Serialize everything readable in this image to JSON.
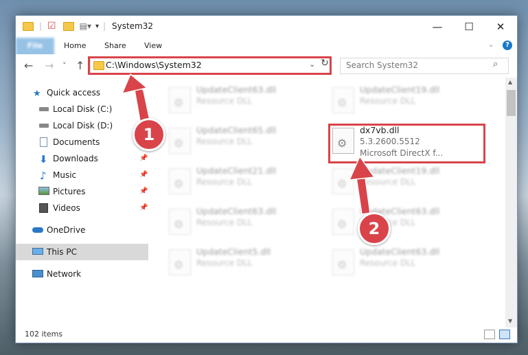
{
  "window": {
    "title": "System32",
    "controls": {
      "minimize": "—",
      "maximize": "☐",
      "close": "✕"
    }
  },
  "ribbon": {
    "tabs": [
      "File",
      "Home",
      "Share",
      "View"
    ],
    "help": "?"
  },
  "navigation": {
    "back": "←",
    "forward": "→",
    "recent": "˅",
    "up": "↑",
    "address": "C:\\Windows\\System32",
    "search_placeholder": "Search System32",
    "refresh": "↻"
  },
  "sidebar": {
    "items": [
      {
        "label": "Quick access",
        "icon": "star-icon",
        "pinned": false
      },
      {
        "label": "Local Disk (C:)",
        "icon": "drive-icon",
        "pinned": false
      },
      {
        "label": "Local Disk (D:)",
        "icon": "drive-icon",
        "pinned": false
      },
      {
        "label": "Documents",
        "icon": "documents-icon",
        "pinned": false
      },
      {
        "label": "Downloads",
        "icon": "download-icon",
        "pinned": true
      },
      {
        "label": "Music",
        "icon": "music-icon",
        "pinned": true
      },
      {
        "label": "Pictures",
        "icon": "pictures-icon",
        "pinned": true
      },
      {
        "label": "Videos",
        "icon": "videos-icon",
        "pinned": true
      },
      {
        "label": "OneDrive",
        "icon": "cloud-icon",
        "pinned": false
      },
      {
        "label": "This PC",
        "icon": "pc-icon",
        "pinned": false,
        "selected": true
      },
      {
        "label": "Network",
        "icon": "network-icon",
        "pinned": false
      }
    ]
  },
  "files": [
    {
      "name": "UpdateClient63.dll",
      "line2": "Resource DLL",
      "line3": ""
    },
    {
      "name": "UpdateClient19.dll",
      "line2": "Resource DLL",
      "line3": ""
    },
    {
      "name": "UpdateClient65.dll",
      "line2": "Resource DLL",
      "line3": ""
    },
    {
      "name": "dx7vb.dll",
      "line2": "5.3.2600.5512",
      "line3": "Microsoft DirectX f..."
    },
    {
      "name": "UpdateClient21.dll",
      "line2": "Resource DLL",
      "line3": ""
    },
    {
      "name": "UpdateClient19.dll",
      "line2": "Resource DLL",
      "line3": ""
    },
    {
      "name": "UpdateClient63.dll",
      "line2": "Resource DLL",
      "line3": ""
    },
    {
      "name": "UpdateClient63.dll",
      "line2": "Resource DLL",
      "line3": ""
    },
    {
      "name": "UpdateClient5.dll",
      "line2": "Resource DLL",
      "line3": ""
    },
    {
      "name": "UpdateClient63.dll",
      "line2": "Resource DLL",
      "line3": ""
    }
  ],
  "status": {
    "count": "102 items"
  },
  "annotations": {
    "badge1": "1",
    "badge2": "2"
  },
  "colors": {
    "accent": "#1979ca",
    "annotation": "#d8444a"
  }
}
